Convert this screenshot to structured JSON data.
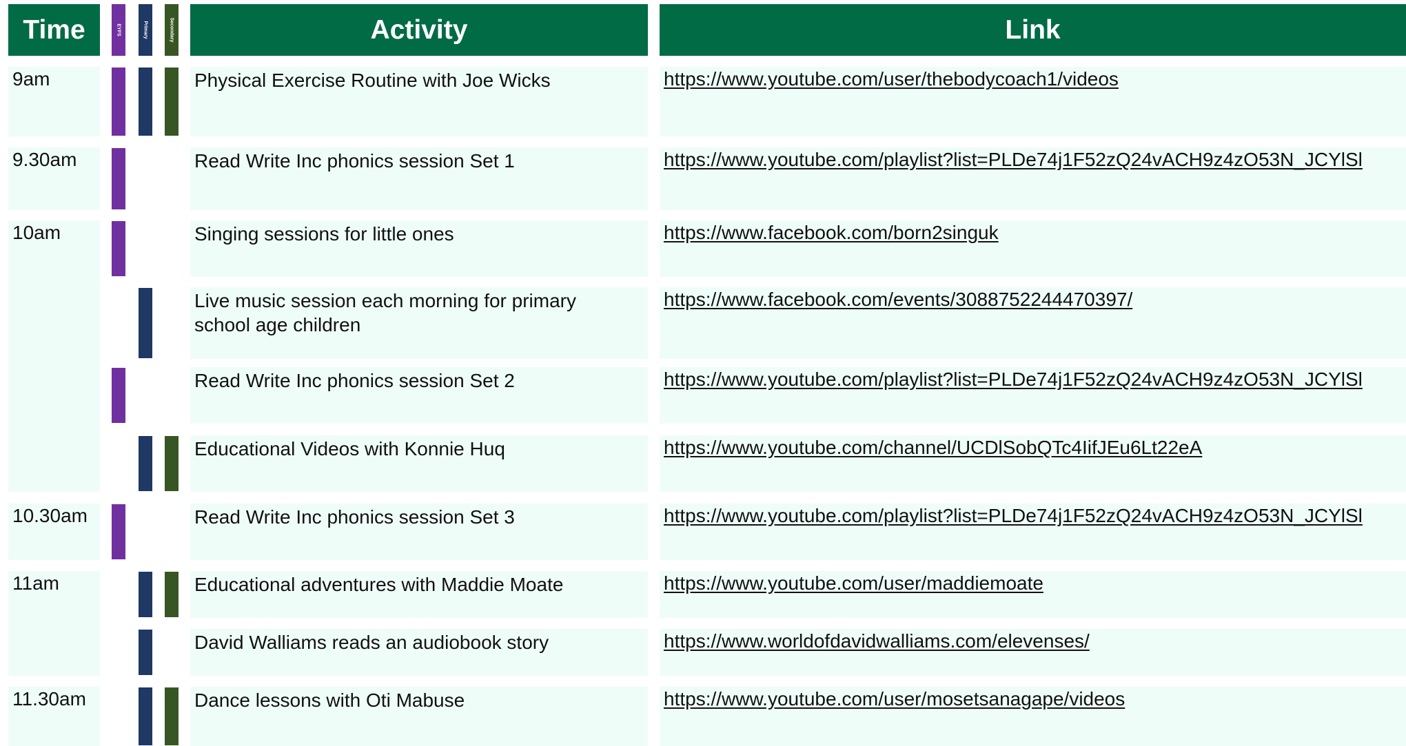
{
  "header": {
    "time": "Time",
    "eyfs": "EYFS",
    "primary": "Primary",
    "secondary": "Secondary",
    "activity": "Activity",
    "link": "Link"
  },
  "colors": {
    "header_bg": "#006b45",
    "row_bg": "#effdf9",
    "eyfs": "#7030a0",
    "primary": "#1f3864",
    "secondary": "#375623"
  },
  "times": [
    "9am",
    "9.30am",
    "10am",
    "10.30am",
    "11am",
    "11.30am"
  ],
  "rows": [
    {
      "activity": "Physical Exercise Routine with Joe Wicks",
      "link": "https://www.youtube.com/user/thebodycoach1/videos",
      "eyfs": true,
      "primary": true,
      "secondary": true
    },
    {
      "activity": "Read Write Inc phonics session Set 1",
      "link": "https://www.youtube.com/playlist?list=PLDe74j1F52zQ24vACH9z4zO53N_JCYlSl",
      "eyfs": true,
      "primary": false,
      "secondary": false
    },
    {
      "activity": "Singing sessions for little ones",
      "link": "https://www.facebook.com/born2singuk",
      "eyfs": true,
      "primary": false,
      "secondary": false
    },
    {
      "activity": "Live music session each morning for primary school age children",
      "link": "https://www.facebook.com/events/3088752244470397/",
      "eyfs": false,
      "primary": true,
      "secondary": false
    },
    {
      "activity": "Read Write Inc phonics session Set 2",
      "link": "https://www.youtube.com/playlist?list=PLDe74j1F52zQ24vACH9z4zO53N_JCYlSl",
      "eyfs": true,
      "primary": false,
      "secondary": false
    },
    {
      "activity": "Educational Videos with Konnie Huq",
      "link": "https://www.youtube.com/channel/UCDlSobQTc4IifJEu6Lt22eA",
      "eyfs": false,
      "primary": true,
      "secondary": true
    },
    {
      "activity": "Read Write Inc phonics session Set 3",
      "link": "https://www.youtube.com/playlist?list=PLDe74j1F52zQ24vACH9z4zO53N_JCYlSl",
      "eyfs": true,
      "primary": false,
      "secondary": false
    },
    {
      "activity": "Educational adventures with Maddie Moate",
      "link": "https://www.youtube.com/user/maddiemoate",
      "eyfs": false,
      "primary": true,
      "secondary": true
    },
    {
      "activity": "David Walliams reads an audiobook story",
      "link": "https://www.worldofdavidwalliams.com/elevenses/",
      "eyfs": false,
      "primary": true,
      "secondary": false
    },
    {
      "activity": "Dance lessons with Oti Mabuse",
      "link": "https://www.youtube.com/user/mosetsanagape/videos",
      "eyfs": false,
      "primary": true,
      "secondary": true
    }
  ]
}
